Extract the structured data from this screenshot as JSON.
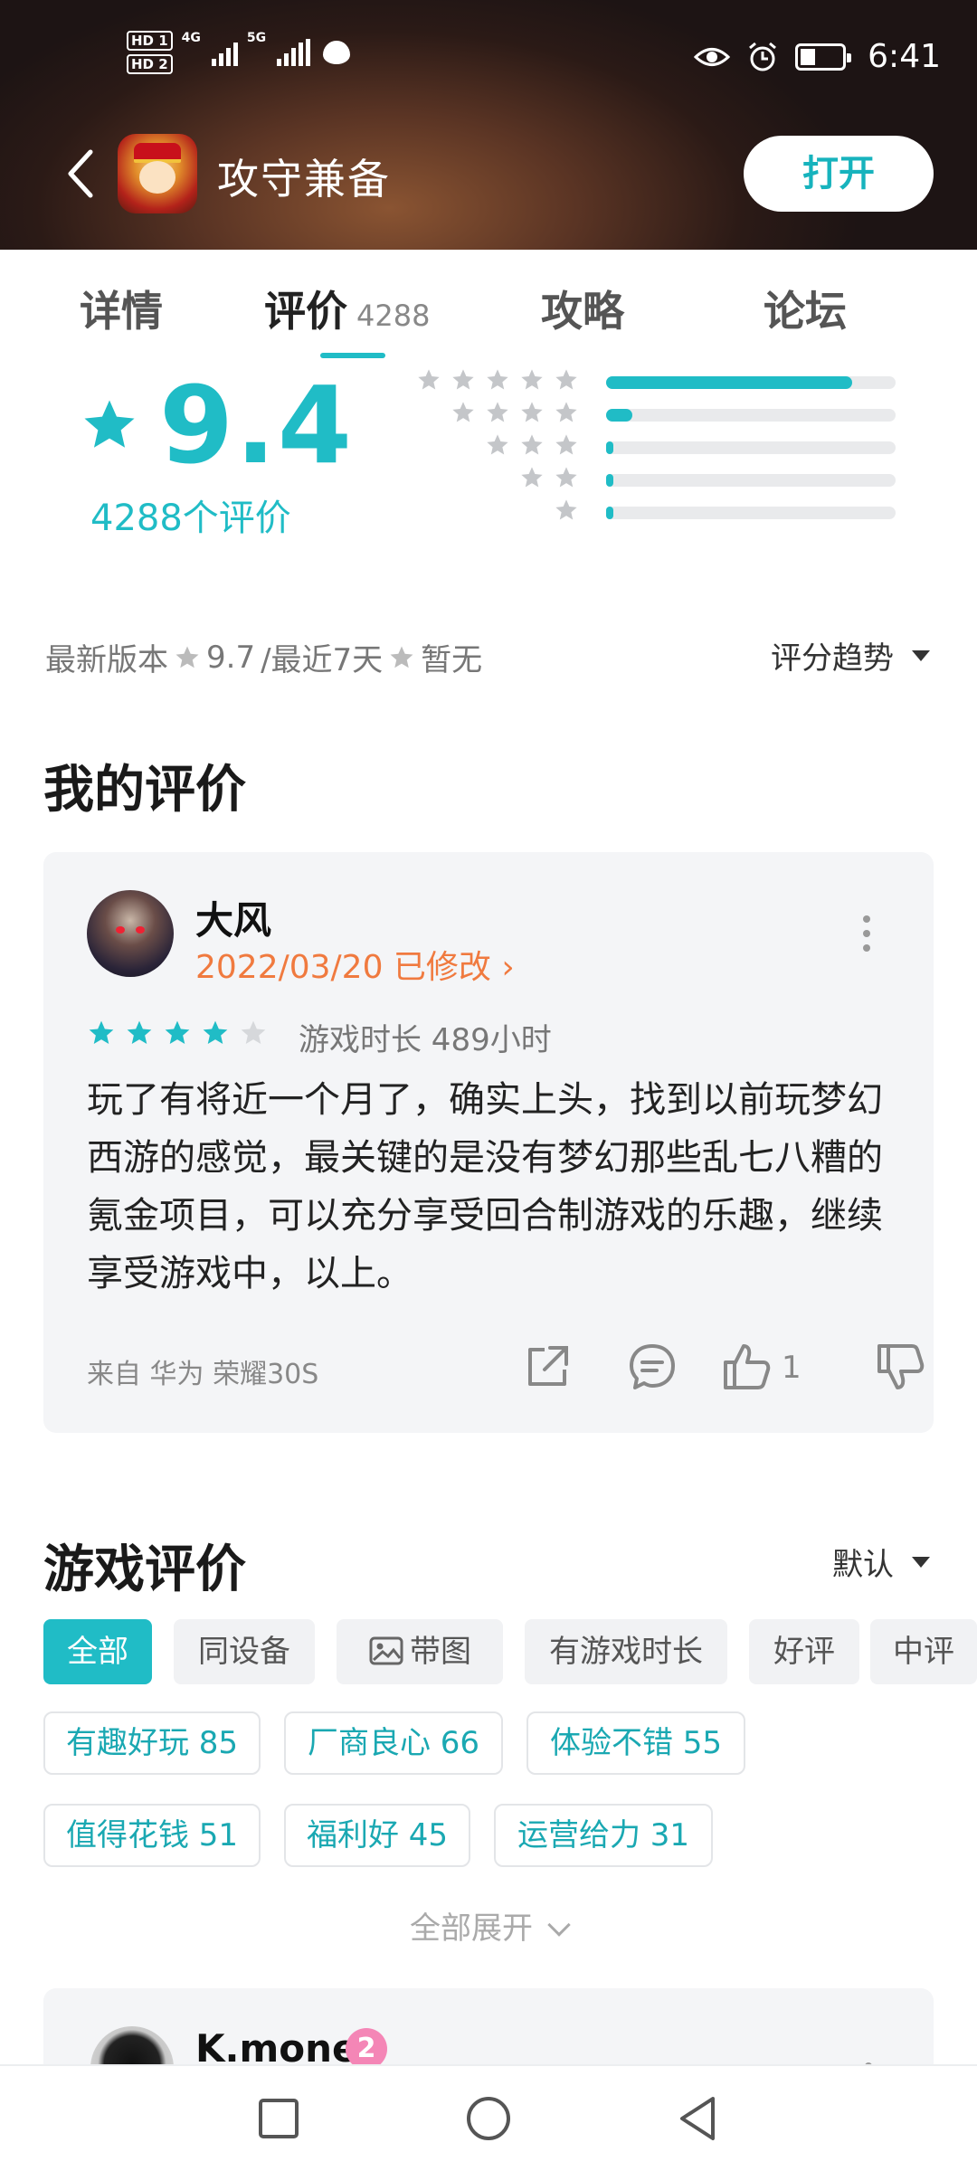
{
  "status_bar": {
    "time": "6:41",
    "network_4g": "4G",
    "network_5g": "5G",
    "sim1": "HD 1",
    "sim2": "HD 2"
  },
  "app": {
    "title": "攻守兼备",
    "open_label": "打开"
  },
  "tabs": [
    {
      "label": "详情"
    },
    {
      "label": "评价",
      "count": "4288"
    },
    {
      "label": "攻略"
    },
    {
      "label": "论坛"
    }
  ],
  "rating": {
    "score": "9.4",
    "count_label": "4288个评价",
    "distribution": [
      0.85,
      0.09,
      0.02,
      0.01,
      0.01
    ]
  },
  "version_line": {
    "latest_label": "最新版本",
    "latest_score": "9.7",
    "recent_label": "/最近7天",
    "recent_score": "暂无"
  },
  "trend": {
    "label": "评分趋势"
  },
  "my_review": {
    "heading": "我的评价",
    "user": "大风",
    "date": "2022/03/20 已修改",
    "stars": 4,
    "playtime": "游戏时长 489小时",
    "text": "玩了有将近一个月了，确实上头，找到以前玩梦幻西游的感觉，最关键的是没有梦幻那些乱七八糟的氪金项目，可以充分享受回合制游戏的乐趣，继续享受游戏中，以上。",
    "device": "来自 华为 荣耀30S",
    "likes": "1"
  },
  "game_reviews": {
    "heading": "游戏评价",
    "sort_label": "默认",
    "filters": [
      "全部",
      "同设备",
      "带图",
      "有游戏时长",
      "好评",
      "中评"
    ],
    "tags": [
      "有趣好玩 85",
      "厂商良心 66",
      "体验不错 55",
      "值得花钱 51",
      "福利好 45",
      "运营给力 31"
    ],
    "expand_label": "全部展开"
  },
  "next_review": {
    "user": "K.mone",
    "badge": "2"
  },
  "colors": {
    "accent": "#20bcc6",
    "date_orange": "#f07a3f"
  }
}
